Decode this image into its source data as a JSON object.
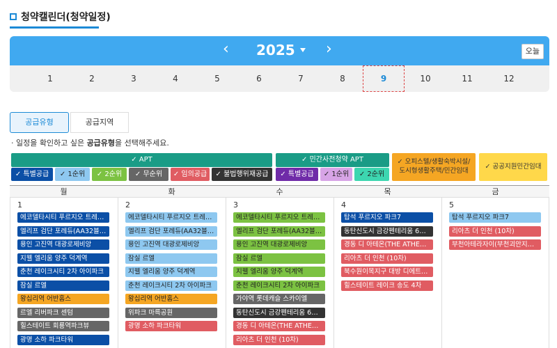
{
  "title": "청약캘린더(청약일정)",
  "year": {
    "value": "2025",
    "prev_icon": "‹",
    "next_icon": "›",
    "today_label": "오늘"
  },
  "months": [
    "1",
    "2",
    "3",
    "4",
    "5",
    "6",
    "7",
    "8",
    "9",
    "10",
    "11",
    "12"
  ],
  "active_month": "9",
  "tabs": [
    "공급유형",
    "공급지역"
  ],
  "notice": {
    "pre": "· 일정을 확인하고 싶은 ",
    "bold": "공급유형",
    "post": "을 선택해주세요."
  },
  "groups": {
    "apt": "✓ APT",
    "minpre": "✓ 민간사전청약 APT",
    "office_line1": "✓ 오피스텔/생활숙박시설/",
    "office_line2": "도시형생활주택/민간임대",
    "public": "✓ 공공지원민간임대"
  },
  "chips": [
    {
      "label": "✓ 특별공급",
      "color": "#0b4fa6"
    },
    {
      "label": "✓ 1순위",
      "color": "#8ec8f0"
    },
    {
      "label": "✓ 2순위",
      "color": "#7cc242"
    },
    {
      "label": "✓ 무순위",
      "color": "#666666"
    },
    {
      "label": "✓ 임의공급",
      "color": "#e05c62"
    },
    {
      "label": "✓ 불법행위재공급",
      "color": "#333333"
    },
    {
      "label": "✓ 특별공급",
      "color": "#6f2ba8"
    },
    {
      "label": "✓ 1순위",
      "color": "#d7a4e6"
    },
    {
      "label": "✓ 2순위",
      "color": "#3dd6b0"
    }
  ],
  "days": [
    {
      "name": "월",
      "date": "1",
      "events": [
        {
          "text": "에코델타시티 푸르지오 트레파…",
          "color": "#0b4fa6"
        },
        {
          "text": "엘리프 검단 포레듀(AA32블록)",
          "color": "#0b4fa6"
        },
        {
          "text": "용인 고진역 대광로제비앙",
          "color": "#0b4fa6"
        },
        {
          "text": "지웰 엘리움 양주 덕계역",
          "color": "#0b4fa6"
        },
        {
          "text": "춘천 레이크시티 2차 아이파크",
          "color": "#0b4fa6"
        },
        {
          "text": "잠실 르엘",
          "color": "#0b4fa6"
        },
        {
          "text": "왕십리역 어반홈스",
          "color": "#f5a623"
        },
        {
          "text": "르엘 리버파크 센텀",
          "color": "#666666"
        },
        {
          "text": "힐스테이트 회룡역파크뷰",
          "color": "#666666"
        },
        {
          "text": "광명 소하 파크타워",
          "color": "#0b4fa6"
        }
      ]
    },
    {
      "name": "화",
      "date": "2",
      "events": [
        {
          "text": "에코델타시티 푸르지오 트레파…",
          "color": "#8ec8f0"
        },
        {
          "text": "엘리프 검단 포레듀(AA32블록)",
          "color": "#8ec8f0"
        },
        {
          "text": "용인 고진역 대광로제비앙",
          "color": "#8ec8f0"
        },
        {
          "text": "잠실 르엘",
          "color": "#8ec8f0"
        },
        {
          "text": "지웰 엘리움 양주 덕계역",
          "color": "#8ec8f0"
        },
        {
          "text": "춘천 레이크시티 2차 아이파크",
          "color": "#8ec8f0"
        },
        {
          "text": "왕십리역 어반홈스",
          "color": "#f5a623"
        },
        {
          "text": "위파크 마륵공원",
          "color": "#666666"
        },
        {
          "text": "광명 소하 파크타워",
          "color": "#e05c62"
        }
      ]
    },
    {
      "name": "수",
      "date": "3",
      "events": [
        {
          "text": "에코델타시티 푸르지오 트레파…",
          "color": "#7cc242"
        },
        {
          "text": "엘리프 검단 포레듀(AA32블록)",
          "color": "#7cc242"
        },
        {
          "text": "용인 고진역 대광로제비앙",
          "color": "#7cc242"
        },
        {
          "text": "잠실 르엘",
          "color": "#7cc242"
        },
        {
          "text": "지웰 엘리움 양주 덕계역",
          "color": "#7cc242"
        },
        {
          "text": "춘천 레이크시티 2차 아이파크",
          "color": "#7cc242"
        },
        {
          "text": "가야역 롯데캐슬 스카이엘",
          "color": "#666666"
        },
        {
          "text": "동탄신도시 금강펜테리움 6차 …",
          "color": "#333333"
        },
        {
          "text": "경동 디 아테온(THE ATHEON) …",
          "color": "#e05c62"
        },
        {
          "text": "리아츠 더 인천 (10차)",
          "color": "#e05c62"
        }
      ]
    },
    {
      "name": "목",
      "date": "4",
      "events": [
        {
          "text": "탑석 푸르지오 파크7",
          "color": "#0b4fa6"
        },
        {
          "text": "동탄신도시 금강펜테리움 6차 …",
          "color": "#333333"
        },
        {
          "text": "경동 디 아테온(THE ATHEON) …",
          "color": "#e05c62"
        },
        {
          "text": "리아츠 더 인천 (10차)",
          "color": "#e05c62"
        },
        {
          "text": "북수원이목지구 대방 디에트르 …",
          "color": "#e05c62"
        },
        {
          "text": "힐스테이트 레이크 송도 4차",
          "color": "#e05c62"
        }
      ]
    },
    {
      "name": "금",
      "date": "5",
      "events": [
        {
          "text": "탑석 푸르지오 파크7",
          "color": "#8ec8f0"
        },
        {
          "text": "리아츠 더 인천 (10차)",
          "color": "#e05c62"
        },
        {
          "text": "부천아테라자이(부천괴안지구 …",
          "color": "#e05c62"
        }
      ]
    }
  ]
}
